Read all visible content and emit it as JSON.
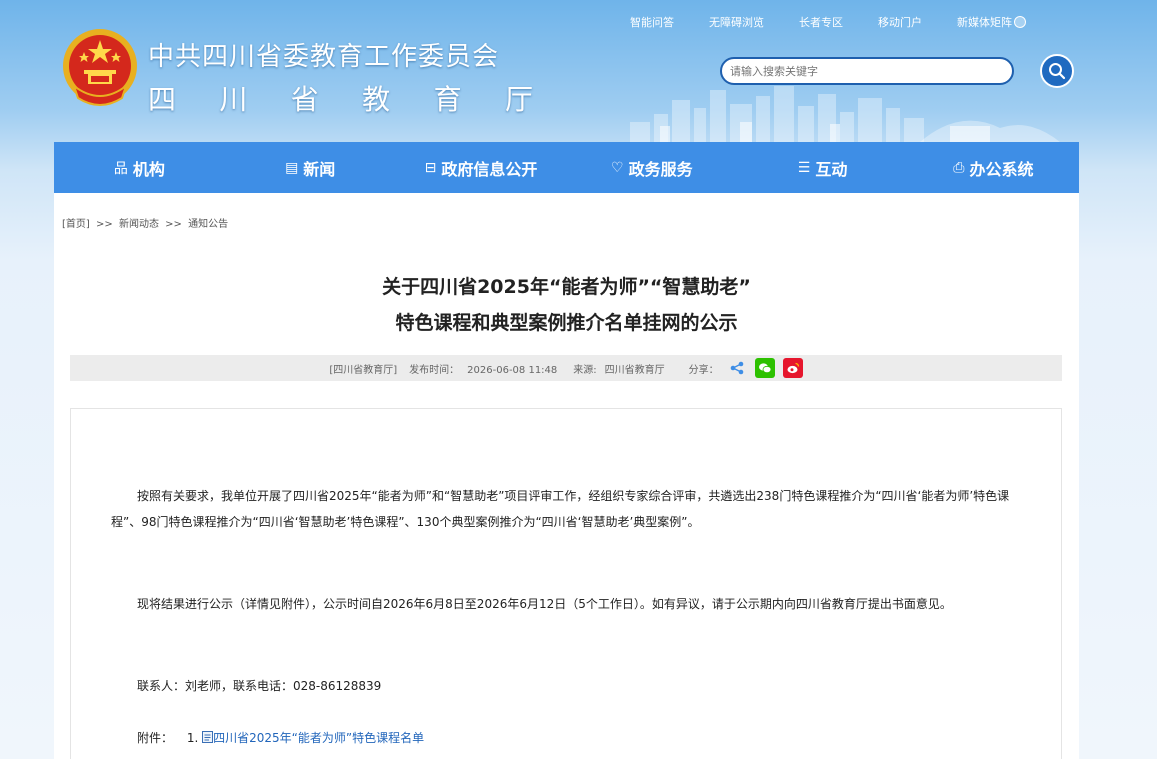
{
  "header": {
    "title_line1": "中共四川省委教育工作委员会",
    "title_line2_chars": [
      "四",
      "川",
      "省",
      "教",
      "育",
      "厅"
    ],
    "toplinks": [
      "智能问答",
      "无障碍浏览",
      "长者专区",
      "移动门户",
      "新媒体矩阵"
    ],
    "search_placeholder": "请输入搜索关键字"
  },
  "nav": [
    {
      "icon": "org-chart-icon",
      "glyph": "品",
      "label": "机构"
    },
    {
      "icon": "news-icon",
      "glyph": "▤",
      "label": "新闻"
    },
    {
      "icon": "folder-icon",
      "glyph": "⊟",
      "label": "政府信息公开"
    },
    {
      "icon": "heart-hands-icon",
      "glyph": "♡",
      "label": "政务服务"
    },
    {
      "icon": "chat-icon",
      "glyph": "☰",
      "label": "互动"
    },
    {
      "icon": "printer-icon",
      "glyph": "⎙",
      "label": "办公系统"
    }
  ],
  "breadcrumb": {
    "home": "[首页]",
    "sep": ">>",
    "level1": "新闻动态",
    "level2": "通知公告"
  },
  "article": {
    "title_line1": "关于四川省2025年“能者为师”“智慧助老”",
    "title_line2": "特色课程和典型案例推介名单挂网的公示",
    "source_tag": "[四川省教育厅]",
    "publish_label": "发布时间：",
    "publish_time": "2026-06-08 11:48",
    "origin_label": "来源:",
    "origin": "四川省教育厅",
    "share_label": "分享：",
    "para1": "按照有关要求，我单位开展了四川省2025年“能者为师”和“智慧助老”项目评审工作，经组织专家综合评审，共遴选出238门特色课程推介为“四川省‘能者为师’特色课程”、98门特色课程推介为“四川省‘智慧助老’特色课程”、130个典型案例推介为“四川省‘智慧助老’典型案例”。",
    "para2": "现将结果进行公示（详情见附件），公示时间自2026年6月8日至2026年6月12日（5个工作日）。如有异议，请于公示期内向四川省教育厅提出书面意见。",
    "contact": "联系人：刘老师，联系电话：028-86128839",
    "attach_label": "附件：",
    "attach_index": "1.",
    "attach_link": "四川省2025年“能者为师”特色课程名单"
  },
  "colors": {
    "nav_bg": "#3e8ee6",
    "link": "#2266bb",
    "search_border": "#1e5fae",
    "wechat": "#2dc100",
    "weibo": "#e6162d"
  }
}
